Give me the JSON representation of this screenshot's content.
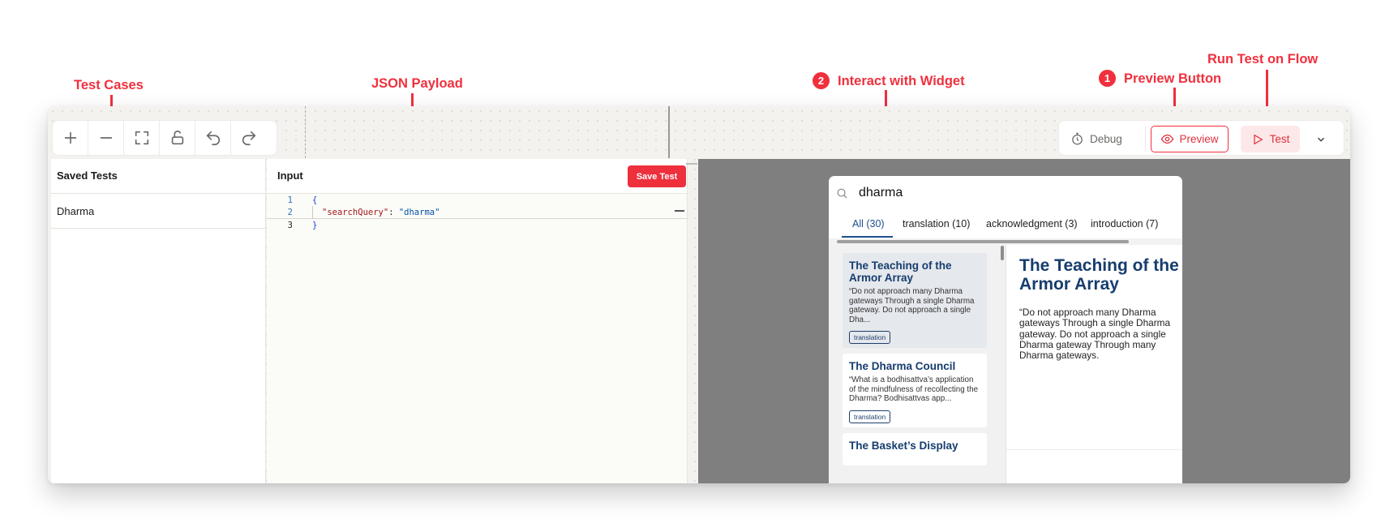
{
  "annotations": {
    "test_cases": "Test Cases",
    "json_payload": "JSON Payload",
    "interact": "Interact with Widget",
    "interact_num": "2",
    "preview": "Preview Button",
    "preview_num": "1",
    "run_test": "Run Test on Flow"
  },
  "actions": {
    "debug": "Debug",
    "preview": "Preview",
    "test": "Test"
  },
  "saved_tests": {
    "title": "Saved Tests",
    "items": [
      "Dharma"
    ]
  },
  "input_panel": {
    "title": "Input",
    "save_label": "Save Test",
    "lines": [
      {
        "num": "1",
        "open": "{"
      },
      {
        "num": "2",
        "key": "\"searchQuery\"",
        "colon": ": ",
        "value": "\"dharma\""
      },
      {
        "num": "3",
        "close": "}"
      }
    ]
  },
  "widget": {
    "query": "dharma",
    "tabs": [
      "All (30)",
      "translation (10)",
      "acknowledgment (3)",
      "introduction (7)"
    ],
    "results": [
      {
        "title": "The Teaching of the Armor Array",
        "snippet": "“Do not approach many Dharma gateways Through a single Dharma gateway. Do not approach a single Dha...",
        "tag": "translation"
      },
      {
        "title": "The Dharma Council",
        "snippet": "“What is a bodhisattva’s application of the mindfulness of recollecting the Dharma? Bodhisattvas app...",
        "tag": "translation"
      },
      {
        "title": "The Basket’s Display",
        "snippet": "",
        "tag": ""
      }
    ],
    "detail": {
      "title": "The Teaching of the Armor Array",
      "text": "“Do not approach many Dharma gateways Through a single Dharma gateway. Do not approach a single Dharma gateway Through many Dharma gateways."
    }
  },
  "colors": {
    "accent": "#f0303d",
    "title_blue": "#163d6e",
    "preview_bg": "#7f7f7f"
  }
}
